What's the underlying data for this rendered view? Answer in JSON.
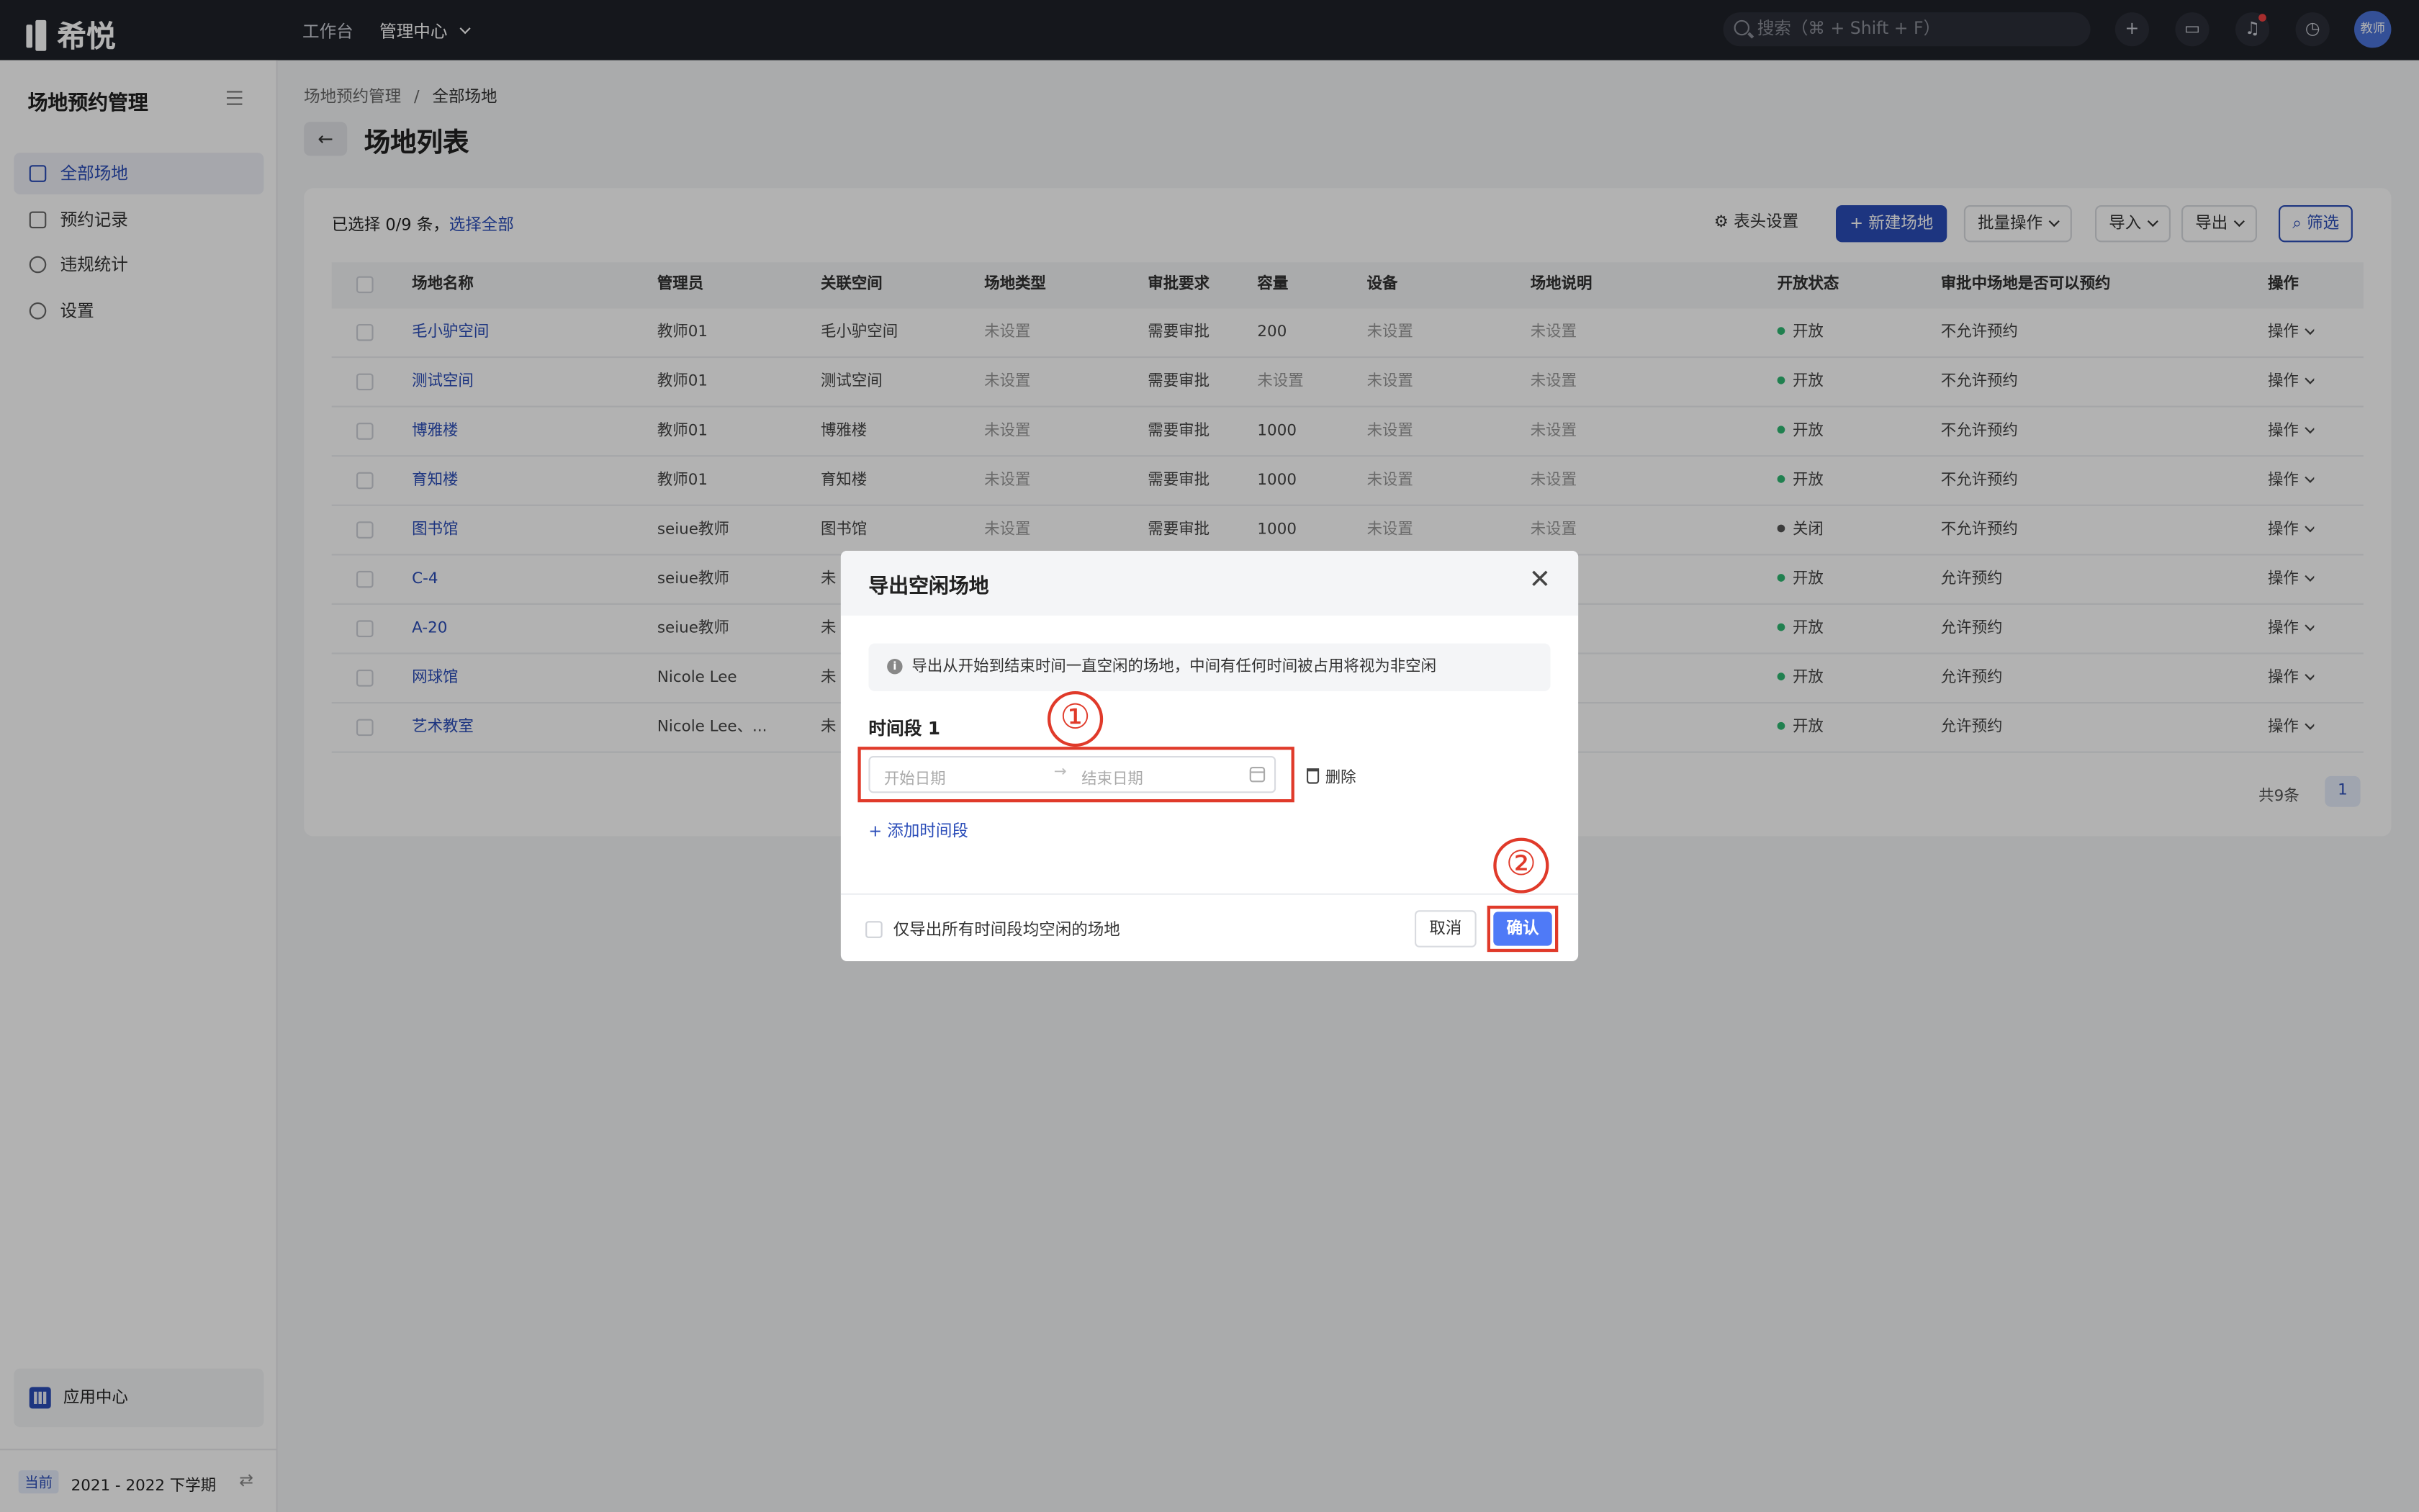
{
  "topbar": {
    "logo": "希悦",
    "nav_workbench": "工作台",
    "nav_admin": "管理中心",
    "search_placeholder": "搜索（⌘ + Shift + F）",
    "avatar": "教师"
  },
  "sidebar": {
    "title": "场地预约管理",
    "items": [
      {
        "label": "全部场地",
        "icon": "venue-icon",
        "active": true
      },
      {
        "label": "预约记录",
        "icon": "record-icon",
        "active": false
      },
      {
        "label": "违规统计",
        "icon": "pie-chart-icon",
        "active": false
      },
      {
        "label": "设置",
        "icon": "gear-icon",
        "active": false
      }
    ],
    "app_center": "应用中心",
    "term_tag": "当前",
    "term": "2021 - 2022 下学期"
  },
  "breadcrumb": {
    "parent": "场地预约管理",
    "sep": "/",
    "current": "全部场地"
  },
  "page_title": "场地列表",
  "toolbar": {
    "selected_prefix": "已选择 0/9 条，",
    "select_all": "选择全部",
    "column_settings": "表头设置",
    "new_venue": "+ 新建场地",
    "batch": "批量操作",
    "import": "导入",
    "export": "导出",
    "filter": "筛选"
  },
  "table": {
    "columns": [
      "场地名称",
      "管理员",
      "关联空间",
      "场地类型",
      "审批要求",
      "容量",
      "设备",
      "场地说明",
      "开放状态",
      "审批中场地是否可以预约",
      "操作"
    ],
    "rows": [
      [
        "毛小驴空间",
        "教师01",
        "毛小驴空间",
        "未设置",
        "需要审批",
        "200",
        "未设置",
        "未设置",
        "开放",
        "不允许预约",
        "操作"
      ],
      [
        "测试空间",
        "教师01",
        "测试空间",
        "未设置",
        "需要审批",
        "未设置",
        "未设置",
        "未设置",
        "开放",
        "不允许预约",
        "操作"
      ],
      [
        "博雅楼",
        "教师01",
        "博雅楼",
        "未设置",
        "需要审批",
        "1000",
        "未设置",
        "未设置",
        "开放",
        "不允许预约",
        "操作"
      ],
      [
        "育知楼",
        "教师01",
        "育知楼",
        "未设置",
        "需要审批",
        "1000",
        "未设置",
        "未设置",
        "开放",
        "不允许预约",
        "操作"
      ],
      [
        "图书馆",
        "seiue教师",
        "图书馆",
        "未设置",
        "需要审批",
        "1000",
        "未设置",
        "未设置",
        "关闭",
        "不允许预约",
        "操作"
      ],
      [
        "C-4",
        "seiue教师",
        "未",
        "",
        "",
        "",
        "",
        "",
        "开放",
        "允许预约",
        "操作"
      ],
      [
        "A-20",
        "seiue教师",
        "未",
        "",
        "",
        "",
        "",
        "",
        "开放",
        "允许预约",
        "操作"
      ],
      [
        "网球馆",
        "Nicole Lee",
        "未",
        "",
        "",
        "",
        "",
        "",
        "开放",
        "允许预约",
        "操作"
      ],
      [
        "艺术教室",
        "Nicole Lee、...",
        "未",
        "",
        "",
        "",
        "",
        "",
        "开放",
        "允许预约",
        "操作"
      ]
    ],
    "status_colors": {
      "open": "#2eb872",
      "closed": "#555555"
    }
  },
  "pagination": {
    "total": "共9条",
    "current": "1"
  },
  "modal": {
    "title": "导出空闲场地",
    "info": "导出从开始到结束时间一直空闲的场地，中间有任何时间被占用将视为非空闲",
    "segment_label": "时间段 1",
    "start_placeholder": "开始日期",
    "end_placeholder": "结束日期",
    "delete": "删除",
    "add_segment": "+ 添加时间段",
    "checkbox_label": "仅导出所有时间段均空闲的场地",
    "cancel": "取消",
    "confirm": "确认",
    "annotation_1": "①",
    "annotation_2": "②"
  },
  "colors": {
    "accent": "#2a4cb8",
    "confirm": "#4f7af7",
    "annotation": "#e03a2a"
  }
}
